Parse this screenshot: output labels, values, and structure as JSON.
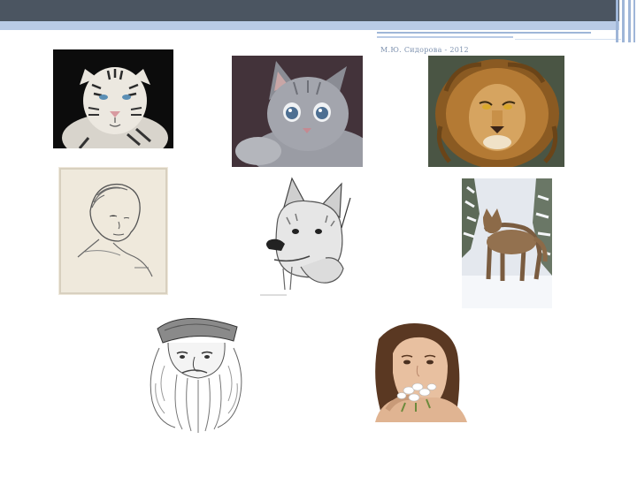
{
  "slide": {
    "footer": "М.Ю. Сидорова - 2012"
  },
  "images": [
    {
      "name": "white-tiger-photo"
    },
    {
      "name": "grey-kitten-photo"
    },
    {
      "name": "lion-painting"
    },
    {
      "name": "child-sketch"
    },
    {
      "name": "wolf-cub-drawing"
    },
    {
      "name": "wolf-in-snow-photo"
    },
    {
      "name": "old-man-sketch"
    },
    {
      "name": "woman-with-flowers-photo"
    }
  ]
}
